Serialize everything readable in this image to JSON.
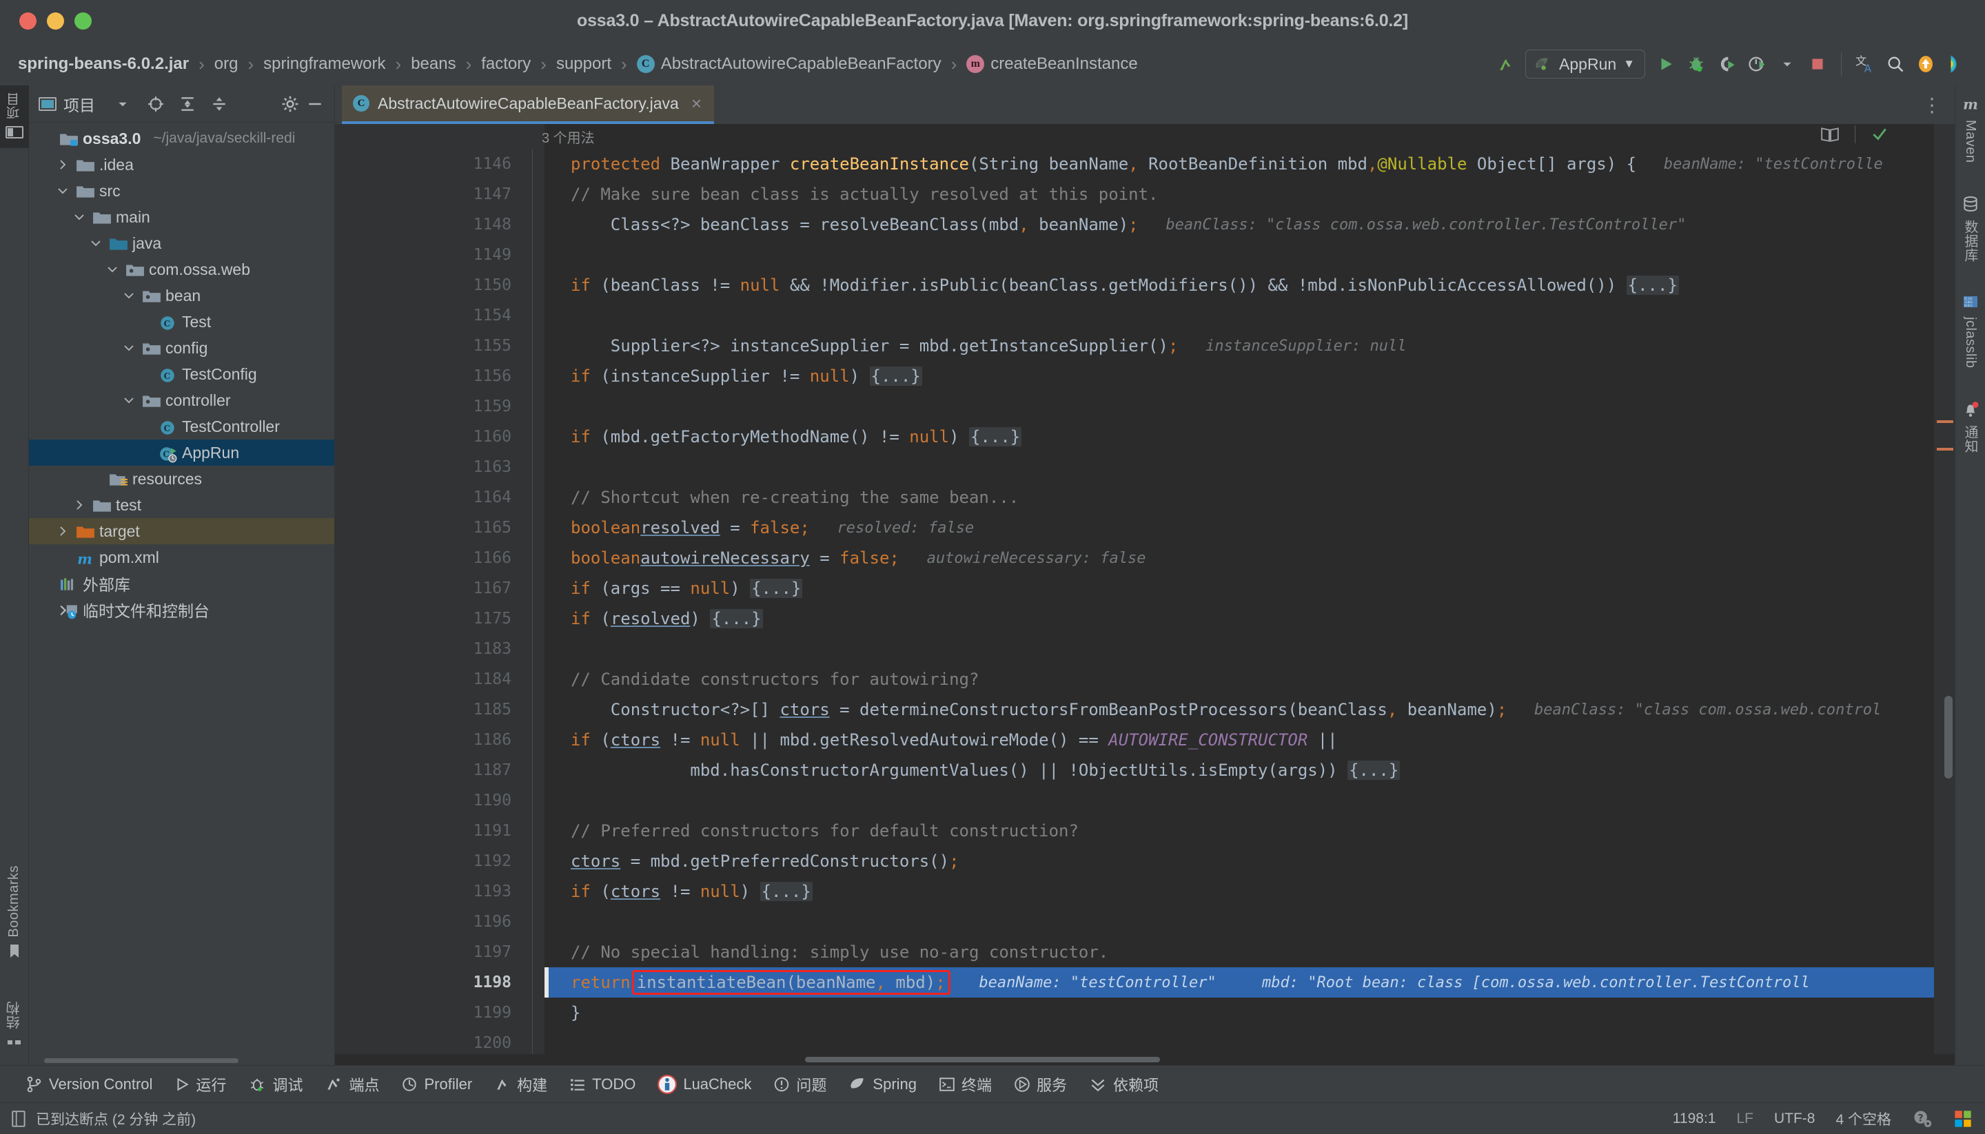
{
  "window": {
    "title": "ossa3.0 – AbstractAutowireCapableBeanFactory.java [Maven: org.springframework:spring-beans:6.0.2]"
  },
  "breadcrumb": {
    "items": [
      {
        "label": "spring-beans-6.0.2.jar",
        "icon": "none"
      },
      {
        "label": "org",
        "icon": "none"
      },
      {
        "label": "springframework",
        "icon": "none"
      },
      {
        "label": "beans",
        "icon": "none"
      },
      {
        "label": "factory",
        "icon": "none"
      },
      {
        "label": "support",
        "icon": "none"
      },
      {
        "label": "AbstractAutowireCapableBeanFactory",
        "icon": "class-icon"
      },
      {
        "label": "createBeanInstance",
        "icon": "method-icon"
      }
    ],
    "separator": "›"
  },
  "toolbar": {
    "build_icon": "hammer-build-icon",
    "run_config": {
      "label": "AppRun",
      "icon": "spring-leaf-icon",
      "chevron": "▼"
    },
    "buttons": [
      {
        "name": "run-button",
        "icon": "play-icon"
      },
      {
        "name": "debug-button",
        "icon": "bug-icon"
      },
      {
        "name": "run-with-coverage-button",
        "icon": "coverage-icon"
      },
      {
        "name": "profiler-button",
        "icon": "profiler-icon"
      },
      {
        "name": "profiler-dropdown",
        "icon": "chevron-down-icon"
      },
      {
        "name": "stop-button",
        "icon": "stop-square-icon"
      },
      {
        "name": "translate-button",
        "icon": "translate-icon"
      },
      {
        "name": "search-everywhere-button",
        "icon": "search-icon"
      },
      {
        "name": "update-project-button",
        "icon": "orange-arrow-up-icon"
      },
      {
        "name": "ide-assistant-button",
        "icon": "rainbow-shield-icon"
      }
    ]
  },
  "left_strip": {
    "top_label": "项目",
    "bookmarks_label": "Bookmarks",
    "structure_label": "结构"
  },
  "project_panel": {
    "title": "项目",
    "header_buttons": [
      {
        "name": "project-view-dropdown",
        "icon": "chevron-down-icon"
      },
      {
        "name": "select-opened-file-button",
        "icon": "crosshair-target-icon"
      },
      {
        "name": "expand-all-button",
        "icon": "expand-all-icon"
      },
      {
        "name": "collapse-all-button",
        "icon": "collapse-all-icon"
      },
      {
        "name": "settings-button",
        "icon": "gear-icon"
      },
      {
        "name": "hide-button",
        "icon": "minus-icon"
      }
    ],
    "tree": [
      {
        "label": "ossa3.0",
        "sub": "~/java/java/seckill-redi",
        "depth": 0,
        "arrow": "",
        "icon": "module-folder",
        "bold": true,
        "state": "none"
      },
      {
        "label": ".idea",
        "depth": 1,
        "arrow": "›",
        "icon": "folder",
        "state": "none"
      },
      {
        "label": "src",
        "depth": 1,
        "arrow": "⌄",
        "icon": "folder",
        "state": "none"
      },
      {
        "label": "main",
        "depth": 2,
        "arrow": "⌄",
        "icon": "folder",
        "state": "none"
      },
      {
        "label": "java",
        "depth": 3,
        "arrow": "⌄",
        "icon": "source-folder",
        "state": "none"
      },
      {
        "label": "com.ossa.web",
        "depth": 4,
        "arrow": "⌄",
        "icon": "package",
        "state": "none"
      },
      {
        "label": "bean",
        "depth": 5,
        "arrow": "⌄",
        "icon": "package",
        "state": "none"
      },
      {
        "label": "Test",
        "depth": 6,
        "arrow": "",
        "icon": "class",
        "state": "none"
      },
      {
        "label": "config",
        "depth": 5,
        "arrow": "⌄",
        "icon": "package",
        "state": "none"
      },
      {
        "label": "TestConfig",
        "depth": 6,
        "arrow": "",
        "icon": "class",
        "state": "none"
      },
      {
        "label": "controller",
        "depth": 5,
        "arrow": "⌄",
        "icon": "package",
        "state": "none"
      },
      {
        "label": "TestController",
        "depth": 6,
        "arrow": "",
        "icon": "class",
        "state": "none"
      },
      {
        "label": "AppRun",
        "depth": 6,
        "arrow": "",
        "icon": "runnable-class",
        "state": "selected-blue"
      },
      {
        "label": "resources",
        "depth": 3,
        "arrow": "",
        "icon": "resources-folder",
        "state": "none"
      },
      {
        "label": "test",
        "depth": 2,
        "arrow": "›",
        "icon": "folder",
        "state": "none"
      },
      {
        "label": "target",
        "depth": 1,
        "arrow": "›",
        "icon": "excluded-folder",
        "state": "selected-olive"
      },
      {
        "label": "pom.xml",
        "depth": 1,
        "arrow": "",
        "icon": "maven",
        "state": "none"
      },
      {
        "label": "外部库",
        "depth": 0,
        "arrow": "",
        "icon": "library",
        "state": "none"
      },
      {
        "label": "临时文件和控制台",
        "depth": 0,
        "arrow": "",
        "icon": "scratches",
        "state": "none"
      }
    ]
  },
  "editor": {
    "tab": {
      "label": "AbstractAutowireCapableBeanFactory.java",
      "icon": "class-icon",
      "close": "×"
    },
    "usages_label": "3 个用法",
    "more_icon": "kebab-menu-icon",
    "reader_mode_icon": "book-icon",
    "inspections_icon": "green-check-icon",
    "lines": [
      {
        "num": "1146",
        "fold": "minus",
        "html": "<span class=\"kw\">protected</span> BeanWrapper <span class=\"mdecl\">createBeanInstance</span>(String beanName<span class=\"kw\">,</span> RootBeanDefinition mbd<span class=\"kw\">,</span> <span class=\"ann\">@Nullable</span> Object[] args) {",
        "hint": "beanName: \"testControlle"
      },
      {
        "num": "1147",
        "fold": "",
        "html": "    <span class=\"cmt\">// Make sure bean class is actually resolved at this point.</span>",
        "hint": ""
      },
      {
        "num": "1148",
        "fold": "",
        "html": "    Class&lt;?&gt; beanClass = resolveBeanClass(mbd<span class=\"kw\">,</span> beanName)<span class=\"kw\">;</span>",
        "hint": "beanClass: \"class com.ossa.web.controller.TestController\""
      },
      {
        "num": "1149",
        "fold": "",
        "html": "",
        "hint": ""
      },
      {
        "num": "1150",
        "fold": "plus",
        "html": "    <span class=\"kw\">if</span> (beanClass != <span class=\"kw\">null</span> &amp;&amp; !Modifier.<span class=\"mi\">isPublic</span>(beanClass.getModifiers()) &amp;&amp; !mbd.isNonPublicAccessAllowed()) <span class=\"fold-ellipsis\">{...}</span>",
        "hint": ""
      },
      {
        "num": "1154",
        "fold": "",
        "html": "",
        "hint": ""
      },
      {
        "num": "1155",
        "fold": "",
        "html": "    Supplier&lt;?&gt; instanceSupplier = mbd.getInstanceSupplier()<span class=\"kw\">;</span>",
        "hint": "instanceSupplier: null"
      },
      {
        "num": "1156",
        "fold": "plus",
        "html": "    <span class=\"kw\">if</span> (instanceSupplier != <span class=\"kw\">null</span>) <span class=\"fold-ellipsis\">{...}</span>",
        "hint": ""
      },
      {
        "num": "1159",
        "fold": "",
        "html": "",
        "hint": ""
      },
      {
        "num": "1160",
        "fold": "plus",
        "html": "    <span class=\"kw\">if</span> (mbd.getFactoryMethodName() != <span class=\"kw\">null</span>) <span class=\"fold-ellipsis\">{...}</span>",
        "hint": ""
      },
      {
        "num": "1163",
        "fold": "",
        "html": "",
        "hint": ""
      },
      {
        "num": "1164",
        "fold": "",
        "html": "    <span class=\"cmt\">// Shortcut when re-creating the same bean...</span>",
        "hint": ""
      },
      {
        "num": "1165",
        "fold": "",
        "html": "    <span class=\"kw\">boolean</span> <span class=\"und\">resolved</span> = <span class=\"kw\">false</span><span class=\"kw\">;</span>",
        "hint": "resolved: false"
      },
      {
        "num": "1166",
        "fold": "",
        "html": "    <span class=\"kw\">boolean</span> <span class=\"und\">autowireNecessary</span> = <span class=\"kw\">false</span><span class=\"kw\">;</span>",
        "hint": "autowireNecessary: false"
      },
      {
        "num": "1167",
        "fold": "plus",
        "html": "    <span class=\"kw\">if</span> (args == <span class=\"kw\">null</span>) <span class=\"fold-ellipsis\">{...}</span>",
        "hint": ""
      },
      {
        "num": "1175",
        "fold": "plus",
        "html": "    <span class=\"kw\">if</span> (<span class=\"und\">resolved</span>) <span class=\"fold-ellipsis\">{...}</span>",
        "hint": ""
      },
      {
        "num": "1183",
        "fold": "",
        "html": "",
        "hint": ""
      },
      {
        "num": "1184",
        "fold": "",
        "html": "    <span class=\"cmt\">// Candidate constructors for autowiring?</span>",
        "hint": ""
      },
      {
        "num": "1185",
        "fold": "",
        "html": "    Constructor&lt;?&gt;[] <span class=\"und\">ctors</span> = determineConstructorsFromBeanPostProcessors(beanClass<span class=\"kw\">,</span> beanName)<span class=\"kw\">;</span>",
        "hint": "beanClass: \"class com.ossa.web.control"
      },
      {
        "num": "1186",
        "fold": "",
        "html": "    <span class=\"kw\">if</span> (<span class=\"und\">ctors</span> != <span class=\"kw\">null</span> || mbd.getResolvedAutowireMode() == <span class=\"stat\">AUTOWIRE_CONSTRUCTOR</span> ||",
        "hint": ""
      },
      {
        "num": "1187",
        "fold": "",
        "html": "            mbd.hasConstructorArgumentValues() || !ObjectUtils.<span class=\"mi\">isEmpty</span>(args)) <span class=\"fold-ellipsis\">{...}</span>",
        "hint": ""
      },
      {
        "num": "1190",
        "fold": "",
        "html": "",
        "hint": ""
      },
      {
        "num": "1191",
        "fold": "",
        "html": "    <span class=\"cmt\">// Preferred constructors for default construction?</span>",
        "hint": ""
      },
      {
        "num": "1192",
        "fold": "",
        "html": "    <span class=\"und\">ctors</span> = mbd.getPreferredConstructors()<span class=\"kw\">;</span>",
        "hint": ""
      },
      {
        "num": "1193",
        "fold": "plus",
        "html": "    <span class=\"kw\">if</span> (<span class=\"und\">ctors</span> != <span class=\"kw\">null</span>) <span class=\"fold-ellipsis\">{...}</span>",
        "hint": ""
      },
      {
        "num": "1196",
        "fold": "",
        "html": "",
        "hint": ""
      },
      {
        "num": "1197",
        "fold": "",
        "html": "    <span class=\"cmt\">// No special handling: simply use no-arg constructor.</span>",
        "hint": ""
      },
      {
        "num": "1198",
        "fold": "",
        "html": "    <span class=\"kw\">return</span> <span class=\"redbox\">instantiateBean(beanName<span class=\"kw\">,</span> mbd)<span class=\"kw\">;</span></span>",
        "hint": "beanName: \"testController\"     mbd: \"Root bean: class [com.ossa.web.controller.TestControll",
        "current": true
      },
      {
        "num": "1199",
        "fold": "minus",
        "html": "}",
        "hint": ""
      },
      {
        "num": "1200",
        "fold": "",
        "html": "",
        "hint": ""
      }
    ]
  },
  "right_strip": {
    "items": [
      {
        "label": "Maven",
        "icon": "maven-icon"
      },
      {
        "label": "数据库",
        "icon": "database-icon"
      },
      {
        "label": "jclasslib",
        "icon": "jclasslib-icon"
      },
      {
        "label": "通知",
        "icon": "bell-notification-icon"
      }
    ]
  },
  "bottom_toolwindows": [
    {
      "label": "Version Control",
      "icon": "vcs-branch-icon"
    },
    {
      "label": "运行",
      "icon": "play-icon"
    },
    {
      "label": "调试",
      "icon": "bug-icon"
    },
    {
      "label": "端点",
      "icon": "endpoints-icon"
    },
    {
      "label": "Profiler",
      "icon": "profiler-icon"
    },
    {
      "label": "构建",
      "icon": "hammer-build-icon"
    },
    {
      "label": "TODO",
      "icon": "todo-list-icon"
    },
    {
      "label": "LuaCheck",
      "icon": "luacheck-icon"
    },
    {
      "label": "问题",
      "icon": "problems-icon"
    },
    {
      "label": "Spring",
      "icon": "spring-leaf-icon"
    },
    {
      "label": "终端",
      "icon": "terminal-icon"
    },
    {
      "label": "服务",
      "icon": "services-icon"
    },
    {
      "label": "依赖项",
      "icon": "dependencies-icon"
    }
  ],
  "status_bar": {
    "icon": "debugger-console-icon",
    "message": "已到达断点 (2 分钟 之前)",
    "caret": "1198:1",
    "line_separator": "LF",
    "encoding": "UTF-8",
    "indent": "4 个空格",
    "help_icon": "question-gear-icon",
    "ide_icon": "windows-squares-icon"
  }
}
